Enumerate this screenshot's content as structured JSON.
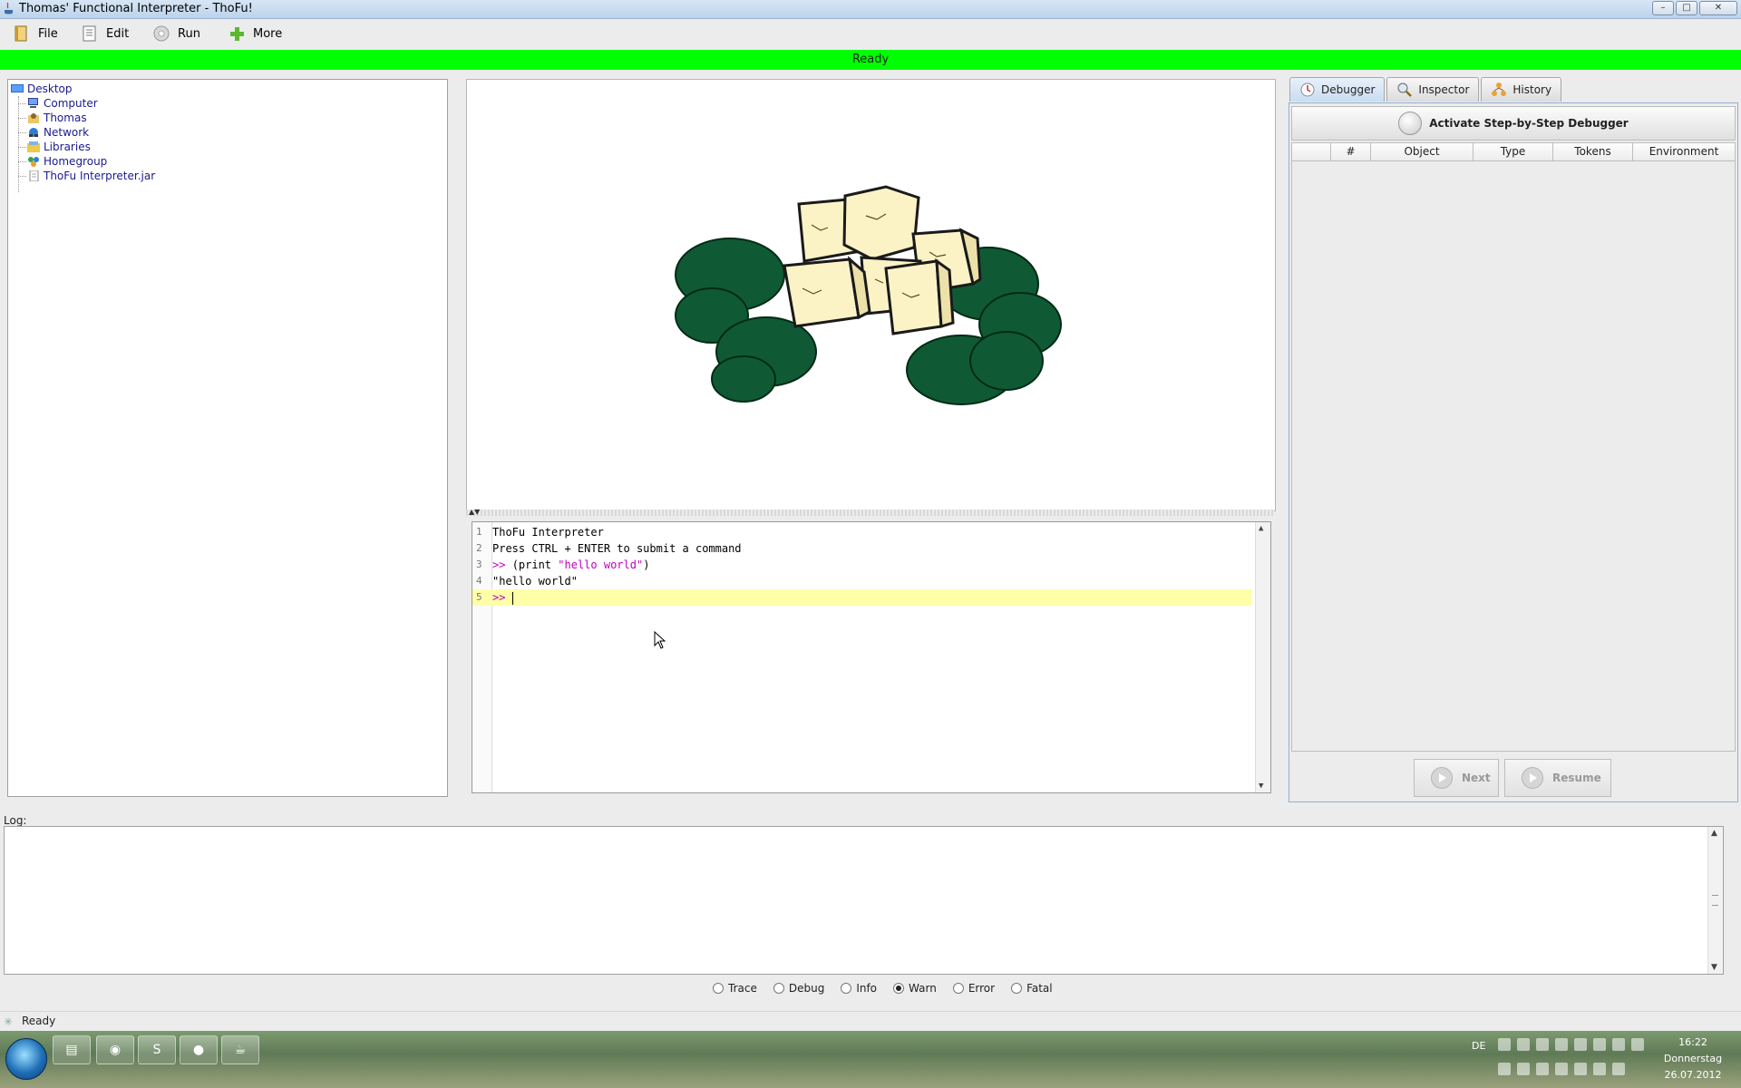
{
  "window": {
    "title": "Thomas' Functional Interpreter - ThoFu!",
    "minimize": "–",
    "maximize": "□",
    "close": "✕"
  },
  "menu": {
    "items": [
      {
        "label": "File",
        "icon": "file-icon"
      },
      {
        "label": "Edit",
        "icon": "edit-icon"
      },
      {
        "label": "Run",
        "icon": "run-icon"
      },
      {
        "label": "More",
        "icon": "plus-icon"
      }
    ]
  },
  "status": {
    "text": "Ready",
    "color": "#00ff00"
  },
  "tree": {
    "root": "Desktop",
    "items": [
      {
        "label": "Computer",
        "icon": "computer-icon"
      },
      {
        "label": "Thomas",
        "icon": "user-folder-icon"
      },
      {
        "label": "Network",
        "icon": "network-icon"
      },
      {
        "label": "Libraries",
        "icon": "libraries-icon"
      },
      {
        "label": "Homegroup",
        "icon": "homegroup-icon"
      },
      {
        "label": "ThoFu Interpreter.jar",
        "icon": "jar-file-icon"
      }
    ]
  },
  "editor": {
    "lines": [
      {
        "num": "1",
        "text": "ThoFu Interpreter"
      },
      {
        "num": "2",
        "text": "Press CTRL + ENTER to submit a command"
      },
      {
        "num": "3",
        "prompt": ">> ",
        "code": "(print ",
        "string": "\"hello world\"",
        "close": ")"
      },
      {
        "num": "4",
        "string": "\"hello world\""
      },
      {
        "num": "5",
        "prompt": ">> "
      }
    ]
  },
  "right_panel": {
    "tabs": [
      {
        "label": "Debugger",
        "icon": "debugger-icon",
        "active": true
      },
      {
        "label": "Inspector",
        "icon": "inspector-icon",
        "active": false
      },
      {
        "label": "History",
        "icon": "history-icon",
        "active": false
      }
    ],
    "activate_label": "Activate Step-by-Step Debugger",
    "columns": [
      "",
      "#",
      "Object",
      "Type",
      "Tokens",
      "Environment"
    ],
    "next_label": "Next",
    "resume_label": "Resume"
  },
  "log": {
    "label": "Log:",
    "levels": [
      {
        "label": "Trace",
        "checked": false
      },
      {
        "label": "Debug",
        "checked": false
      },
      {
        "label": "Info",
        "checked": false
      },
      {
        "label": "Warn",
        "checked": true
      },
      {
        "label": "Error",
        "checked": false
      },
      {
        "label": "Fatal",
        "checked": false
      }
    ]
  },
  "bottom_status": {
    "text": "Ready"
  },
  "taskbar": {
    "language": "DE",
    "time": "16:22",
    "day": "Donnerstag",
    "date": "26.07.2012",
    "apps": [
      "explorer-icon",
      "chrome-icon",
      "skype-icon",
      "purple-app-icon",
      "java-icon"
    ]
  }
}
